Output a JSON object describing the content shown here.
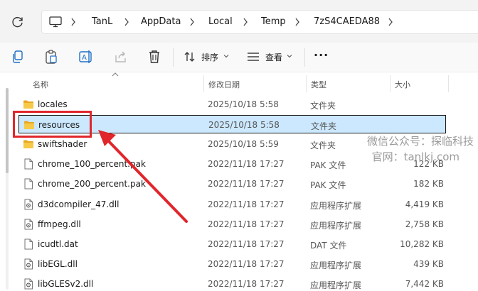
{
  "address_bar": {
    "crumbs": [
      "TanL",
      "AppData",
      "Local",
      "Temp",
      "7zS4CAEDA88"
    ]
  },
  "toolbar": {
    "sort_label": "排序",
    "view_label": "查看",
    "more_label": "···"
  },
  "columns": {
    "name": "名称",
    "date": "修改日期",
    "type": "类型",
    "size": "大小"
  },
  "files": [
    {
      "name": "locales",
      "date": "2025/10/18 5:58",
      "type": "文件夹",
      "size": "",
      "icon": "folder-icon"
    },
    {
      "name": "resources",
      "date": "2025/10/18 5:58",
      "type": "文件夹",
      "size": "",
      "icon": "folder-icon",
      "selected": true
    },
    {
      "name": "swiftshader",
      "date": "2025/10/18 5:59",
      "type": "文件夹",
      "size": "",
      "icon": "folder-icon"
    },
    {
      "name": "chrome_100_percent.pak",
      "date": "2022/11/18 17:27",
      "type": "PAK 文件",
      "size": "122 KB",
      "icon": "file-icon"
    },
    {
      "name": "chrome_200_percent.pak",
      "date": "2022/11/18 17:27",
      "type": "PAK 文件",
      "size": "182 KB",
      "icon": "file-icon"
    },
    {
      "name": "d3dcompiler_47.dll",
      "date": "2022/11/18 17:27",
      "type": "应用程序扩展",
      "size": "4,419 KB",
      "icon": "dll-icon"
    },
    {
      "name": "ffmpeg.dll",
      "date": "2022/11/18 17:27",
      "type": "应用程序扩展",
      "size": "2,758 KB",
      "icon": "dll-icon"
    },
    {
      "name": "icudtl.dat",
      "date": "2022/11/18 17:27",
      "type": "DAT 文件",
      "size": "10,282 KB",
      "icon": "file-icon"
    },
    {
      "name": "libEGL.dll",
      "date": "2022/11/18 17:27",
      "type": "应用程序扩展",
      "size": "439 KB",
      "icon": "dll-icon"
    },
    {
      "name": "libGLESv2.dll",
      "date": "2022/11/18 17:27",
      "type": "应用程序扩展",
      "size": "7,442 KB",
      "icon": "dll-icon"
    }
  ],
  "watermark": {
    "line1": "微信公众号：探临科技",
    "line2": "官网：tanlkj.com"
  },
  "colors": {
    "selection": "#cce8ff",
    "annotation": "#e0262b",
    "folder": "#f5c244"
  }
}
